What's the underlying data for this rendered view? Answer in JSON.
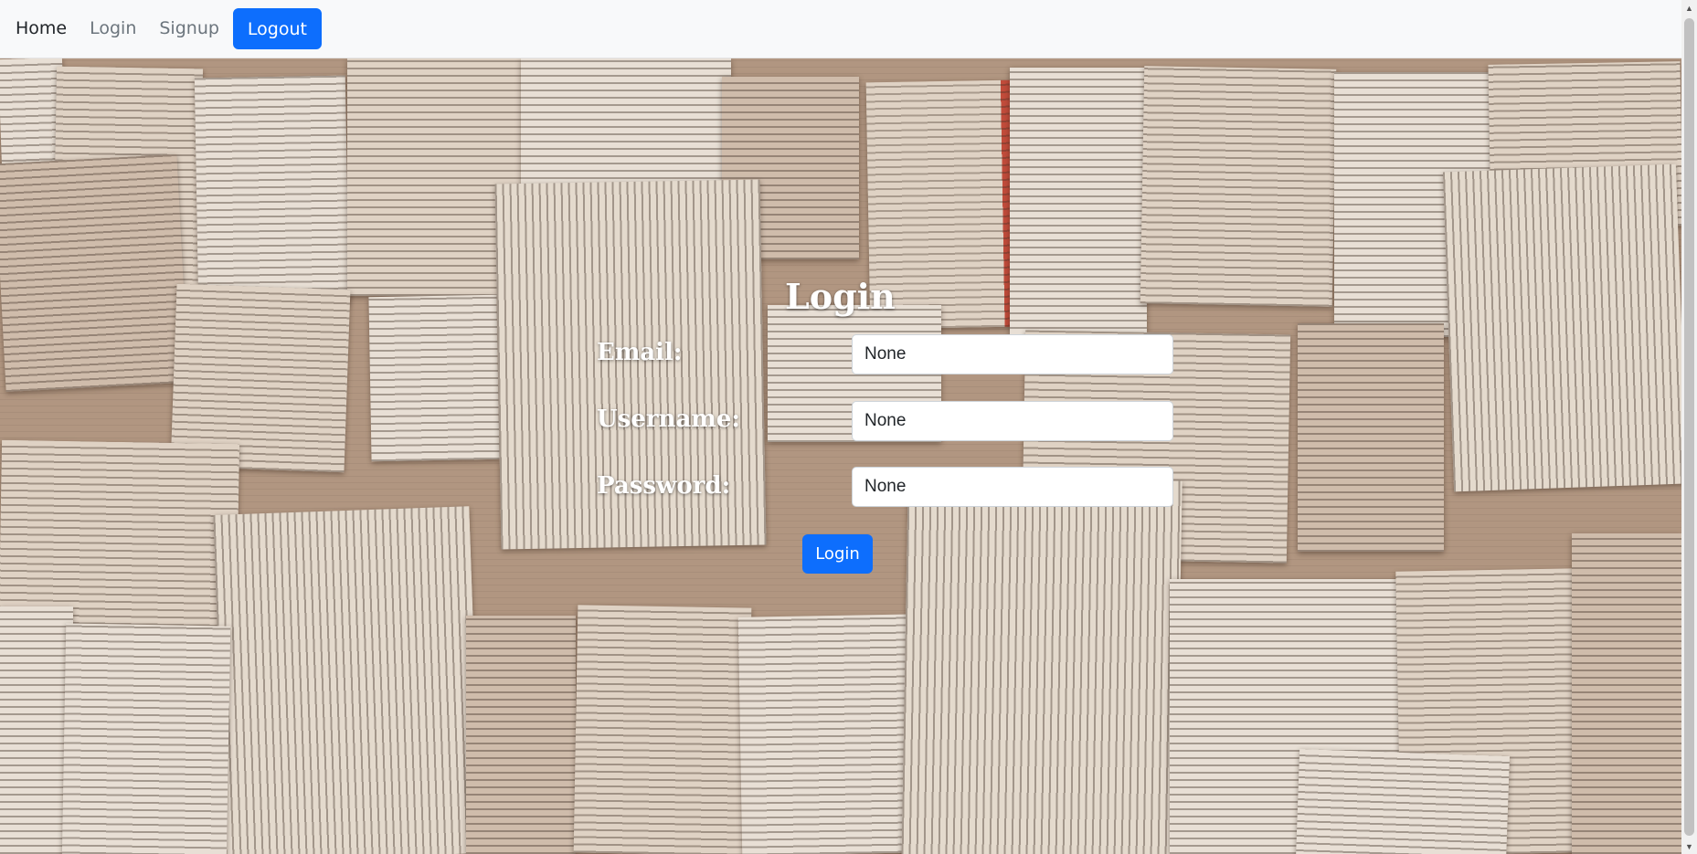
{
  "nav": {
    "home": "Home",
    "login": "Login",
    "signup": "Signup",
    "logout": "Logout"
  },
  "form": {
    "title": "Login",
    "email_label": "Email:",
    "email_value": "None",
    "username_label": "Username:",
    "username_value": "None",
    "password_label": "Password:",
    "password_value": "None",
    "submit_label": "Login"
  },
  "colors": {
    "primary": "#0d6efd",
    "navbar_bg": "#f8f9fa"
  },
  "icons": {
    "scroll_up": "chevron-up-icon",
    "scroll_down": "chevron-down-icon"
  }
}
